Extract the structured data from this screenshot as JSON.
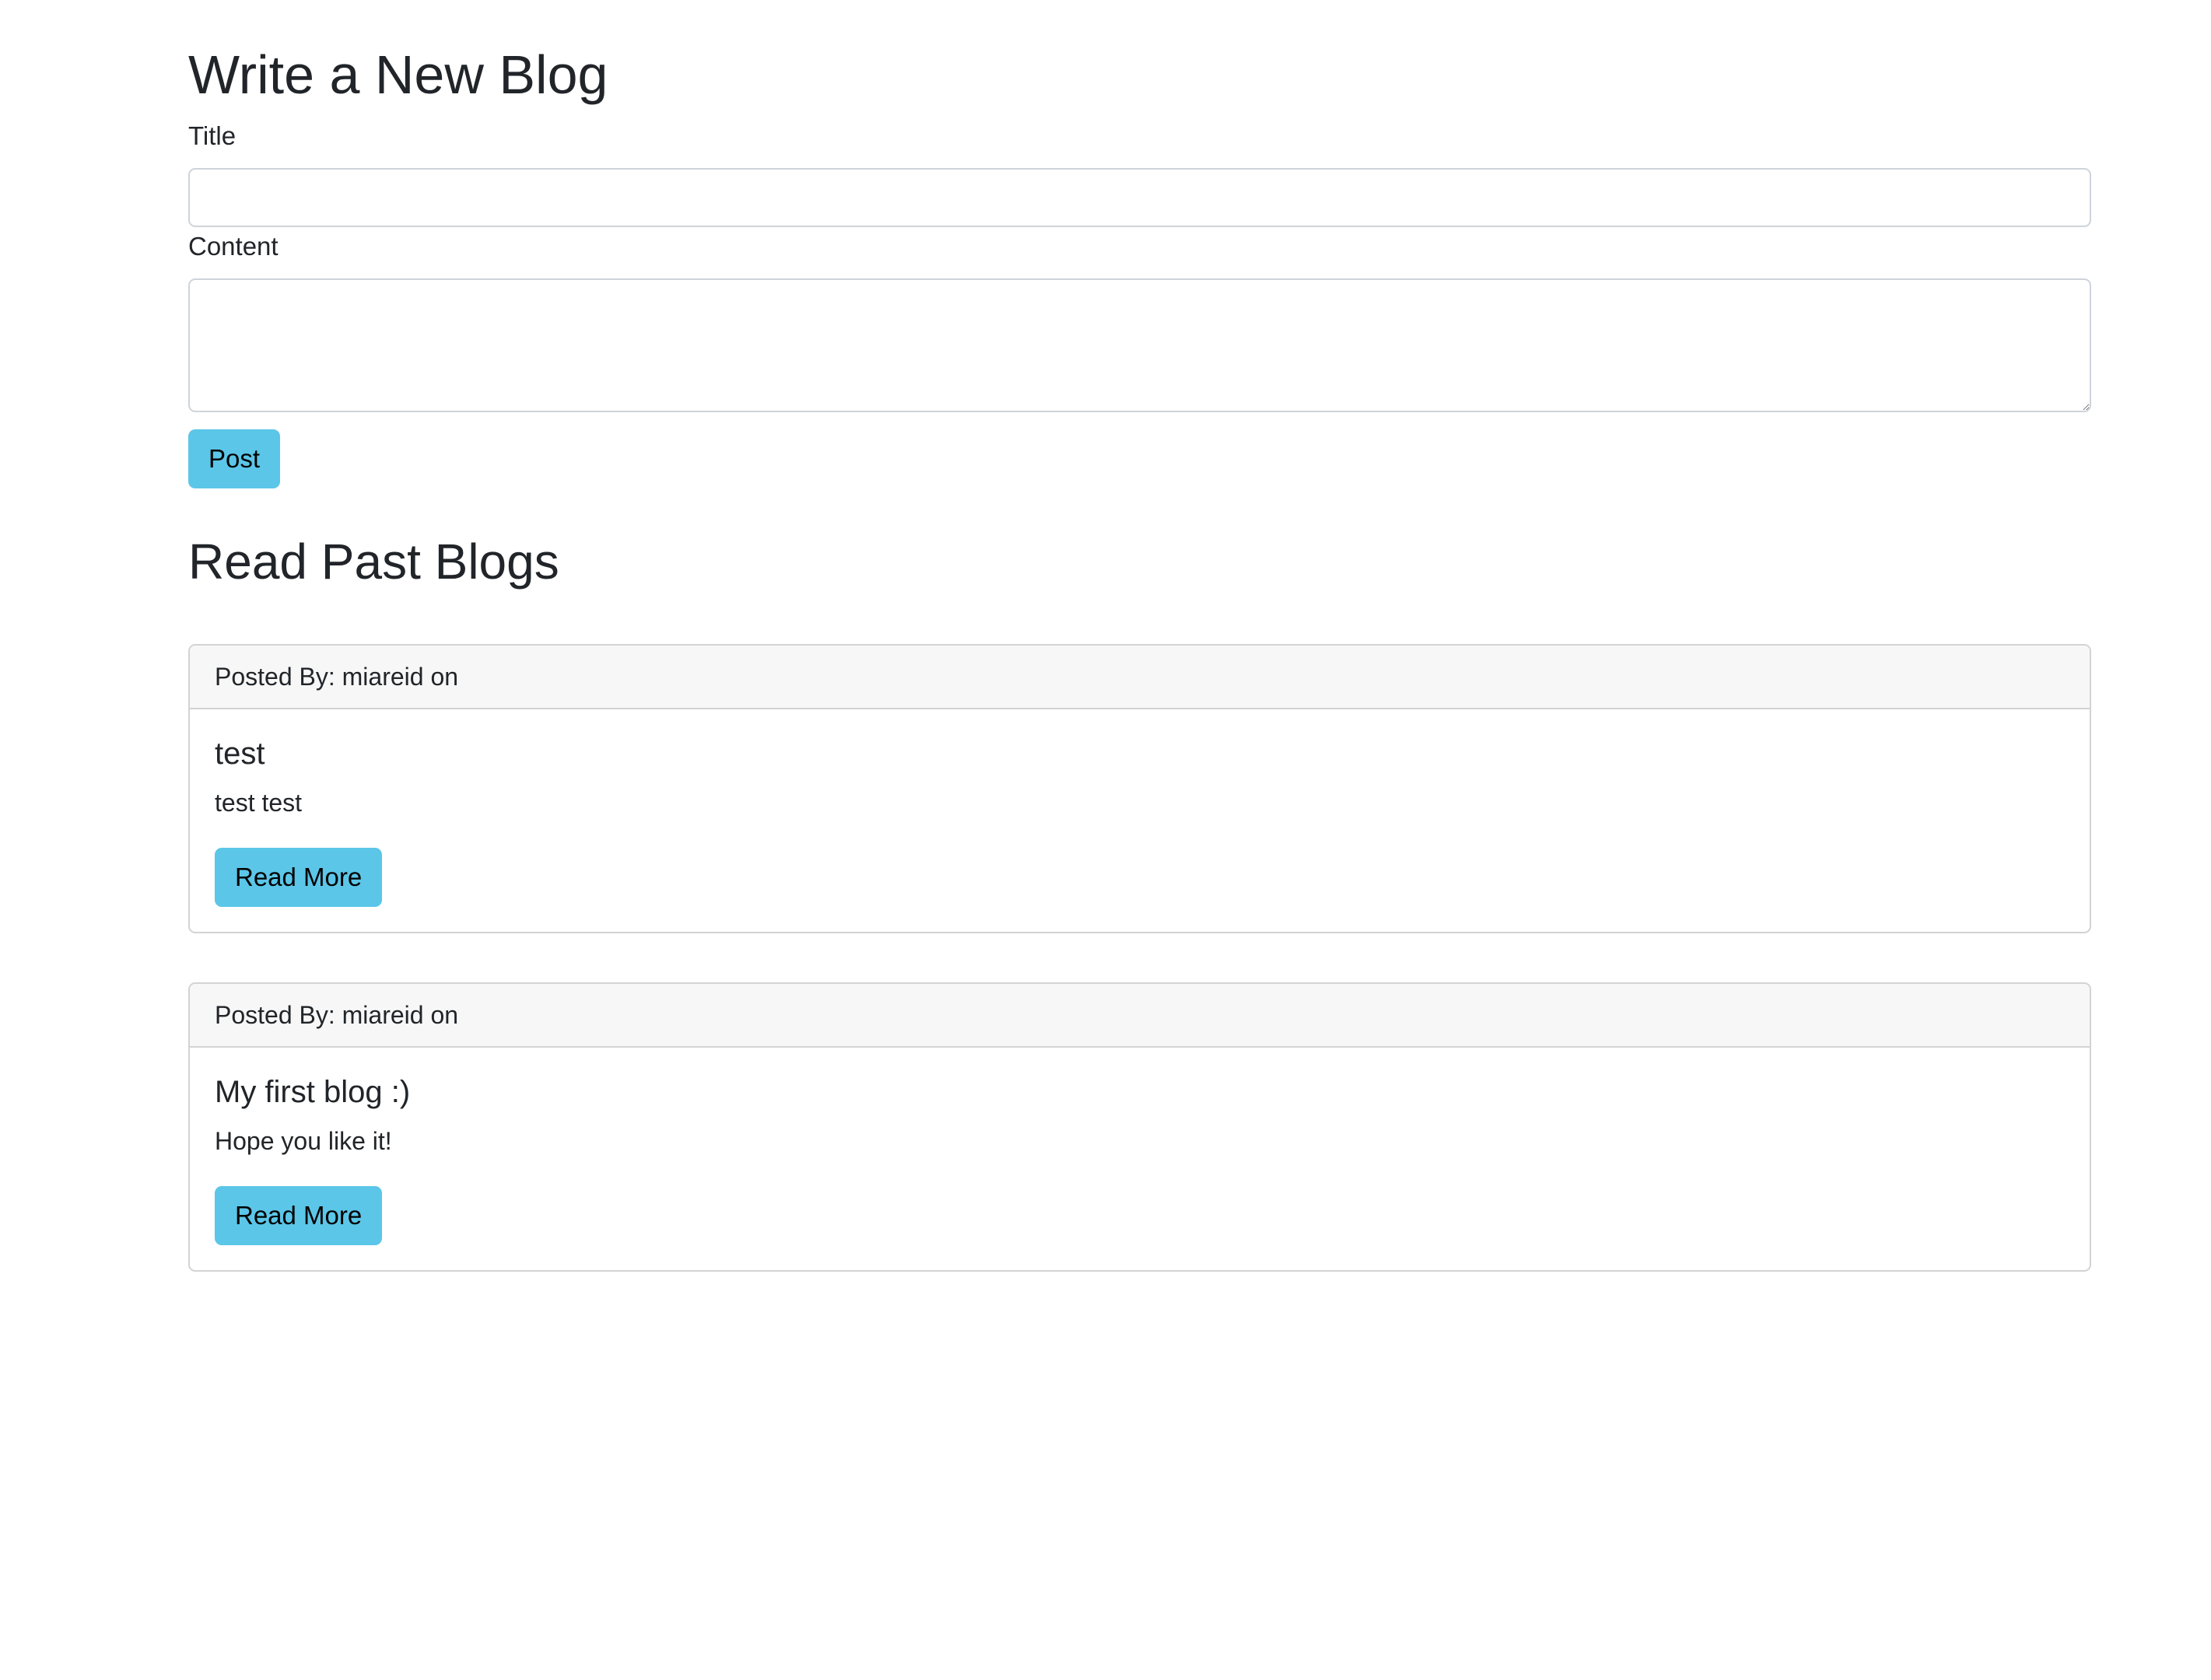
{
  "form": {
    "heading": "Write a New Blog",
    "title_label": "Title",
    "title_value": "",
    "content_label": "Content",
    "content_value": "",
    "post_button": "Post"
  },
  "past": {
    "heading": "Read Past Blogs",
    "posts": [
      {
        "header": "Posted By: miareid on",
        "title": "test",
        "body": "test test",
        "button": "Read More"
      },
      {
        "header": "Posted By: miareid on",
        "title": "My first blog :)",
        "body": "Hope you like it!",
        "button": "Read More"
      }
    ]
  },
  "colors": {
    "button_info": "#5bc6e8",
    "card_header_bg": "#f7f7f7",
    "border": "#d3d3d3",
    "text": "#212529"
  }
}
